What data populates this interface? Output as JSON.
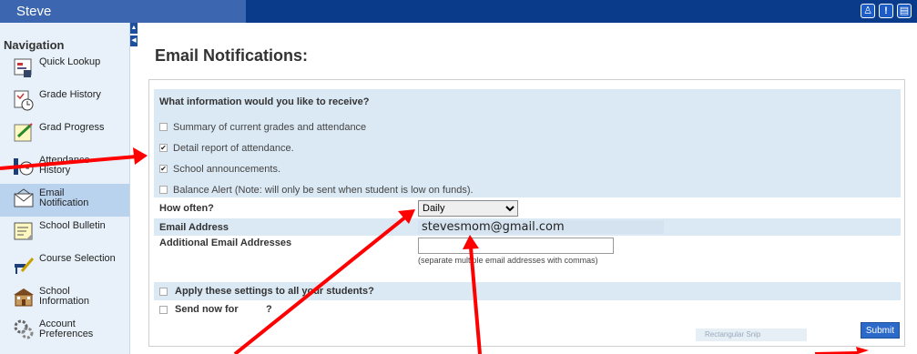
{
  "header": {
    "user_name": "Steve",
    "tools": [
      "person-icon",
      "alert-icon",
      "print-icon"
    ]
  },
  "sidebar": {
    "title": "Navigation",
    "items": [
      {
        "label": "Quick Lookup",
        "icon": "quick-lookup-icon",
        "active": false
      },
      {
        "label": "Grade History",
        "icon": "grade-history-icon",
        "active": false
      },
      {
        "label": "Grad Progress",
        "icon": "grad-progress-icon",
        "active": false
      },
      {
        "label": "Attendance History",
        "icon": "attendance-history-icon",
        "active": false
      },
      {
        "label": "Email Notification",
        "icon": "email-icon",
        "active": true
      },
      {
        "label": "School Bulletin",
        "icon": "bulletin-icon",
        "active": false
      },
      {
        "label": "Course Selection",
        "icon": "course-selection-icon",
        "active": false
      },
      {
        "label": "School Information",
        "icon": "school-icon",
        "active": false
      },
      {
        "label": "Account Preferences",
        "icon": "account-preferences-icon",
        "active": false
      }
    ]
  },
  "main": {
    "title": "Email Notifications:",
    "question": "What information would you like to receive?",
    "options": [
      {
        "label": "Summary of current grades and attendance",
        "checked": false
      },
      {
        "label": "Detail report of attendance.",
        "checked": true
      },
      {
        "label": "School announcements.",
        "checked": true
      },
      {
        "label": "Balance Alert (Note: will only be sent when student is low on funds).",
        "checked": false
      }
    ],
    "how_often_label": "How often?",
    "how_often_value": "Daily",
    "email_label": "Email Address",
    "email_value": "stevesmom@gmail.com",
    "additional_label": "Additional Email Addresses",
    "additional_value": "",
    "additional_hint": "(separate multiple email addresses with commas)",
    "apply_label": "Apply these settings to all your students?",
    "send_label": "Send now for",
    "send_suffix": "?",
    "snip_label": "Rectangular Snip",
    "submit_label": "Submit"
  },
  "colors": {
    "topbar": "#0a3b8a",
    "sidebar": "#e8f1f9",
    "panel_band": "#dbe9f4",
    "arrow": "#ff0000"
  }
}
